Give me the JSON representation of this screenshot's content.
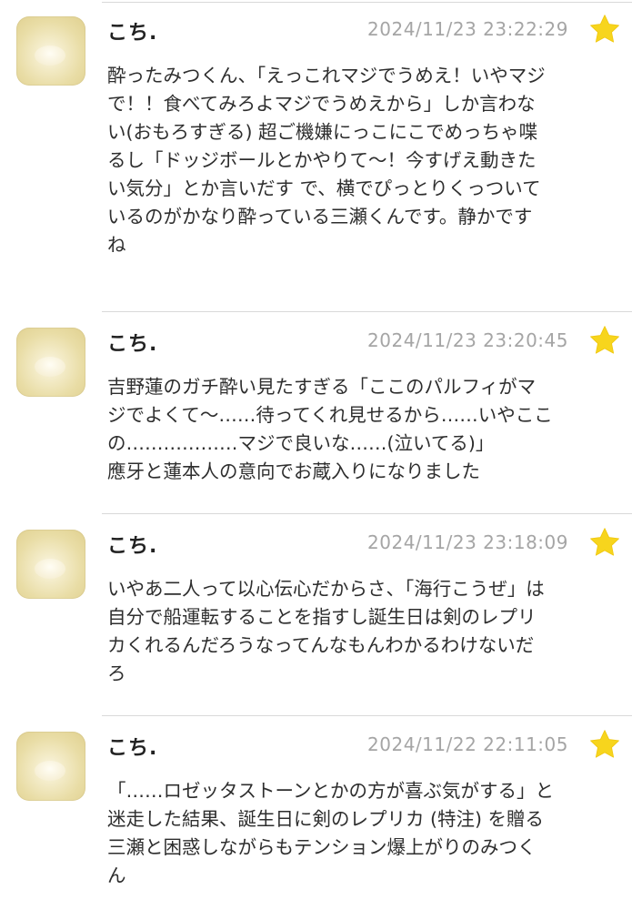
{
  "posts": [
    {
      "author": "こち.",
      "timestamp": "2024/11/23 23:22:29",
      "text": "酔ったみつくん、「えっこれマジでうめえ！いやマジ\nで！！食べてみろよマジでうめえから」しか言わな\nい(おもろすぎる)  超ご機嫌にっこにこでめっちゃ喋\nるし「ドッジボールとかやりて〜！今すげえ動きた\nい気分」とか言いだす  で、横でぴっとりくっついて\nいるのがかなり酔っている三瀬くんです。静かです\nね"
    },
    {
      "author": "こち.",
      "timestamp": "2024/11/23 23:20:45",
      "text": "吉野蓮のガチ酔い見たすぎる「ここのパルフィがマ\nジでよくて〜……待ってくれ見せるから……いやここ\nの………………マジで良いな……(泣いてる)」\n應牙と蓮本人の意向でお蔵入りになりました"
    },
    {
      "author": "こち.",
      "timestamp": "2024/11/23 23:18:09",
      "text": "いやあ二人って以心伝心だからさ、「海行こうぜ」は\n自分で船運転することを指すし誕生日は剣のレプリ\nカくれるんだろうなってんなもんわかるわけないだ\nろ"
    },
    {
      "author": "こち.",
      "timestamp": "2024/11/22 22:11:05",
      "text": "「……ロゼッタストーンとかの方が喜ぶ気がする」と\n迷走した結果、誕生日に剣のレプリカ (特注) を贈る\n三瀬と困惑しながらもテンション爆上がりのみつく\nん"
    }
  ],
  "colors": {
    "star": "#f7d51d",
    "timestamp": "#a5a5a5",
    "divider": "#d9d9d9"
  },
  "icons": {
    "favorite": "star-icon",
    "avatar": "user-avatar"
  }
}
